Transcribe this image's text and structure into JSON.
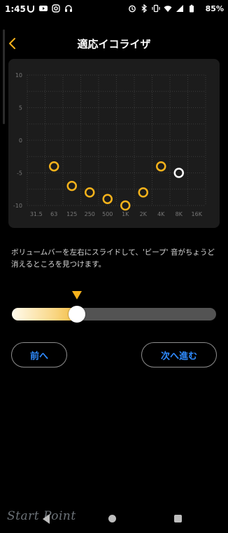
{
  "status_bar": {
    "time": "1:45",
    "left_icons": [
      "u-app-icon",
      "youtube-icon",
      "instagram-icon",
      "headset-icon"
    ],
    "right_icons": [
      "alarm-icon",
      "bluetooth-icon",
      "vibrate-icon",
      "wifi-icon",
      "signal-icon",
      "battery-icon"
    ],
    "battery": "85%"
  },
  "header": {
    "title": "適応イコライザ"
  },
  "chart_data": {
    "type": "scatter",
    "title": "",
    "xlabel": "",
    "ylabel": "",
    "x": [
      "31.5",
      "63",
      "125",
      "250",
      "500",
      "1K",
      "2K",
      "4K",
      "8K",
      "16K"
    ],
    "y_ticks": [
      "10",
      "5",
      "0",
      "-5",
      "-10"
    ],
    "ylim": [
      -10,
      10
    ],
    "grid": true,
    "series": [
      {
        "points": [
          {
            "x": "63",
            "y": -4
          },
          {
            "x": "125",
            "y": -7
          },
          {
            "x": "250",
            "y": -8
          },
          {
            "x": "500",
            "y": -9
          },
          {
            "x": "1K",
            "y": -10
          },
          {
            "x": "2K",
            "y": -8
          },
          {
            "x": "4K",
            "y": -4
          },
          {
            "x": "8K",
            "y": -5
          }
        ],
        "colors": [
          "#f5b21b",
          "#f5b21b",
          "#f5b21b",
          "#f5b21b",
          "#f5b21b",
          "#f5b21b",
          "#f5b21b",
          "#ffffff"
        ]
      }
    ]
  },
  "description": "ボリュームバーを左右にスライドして、'ビープ' 音がちょうど消えるところを見つけます。",
  "slider": {
    "value_percent": 32,
    "accent_color": "#f5b21b"
  },
  "buttons": {
    "prev_label": "前へ",
    "next_label": "次へ進む"
  },
  "navbar": {
    "watermark": "Start Point"
  }
}
